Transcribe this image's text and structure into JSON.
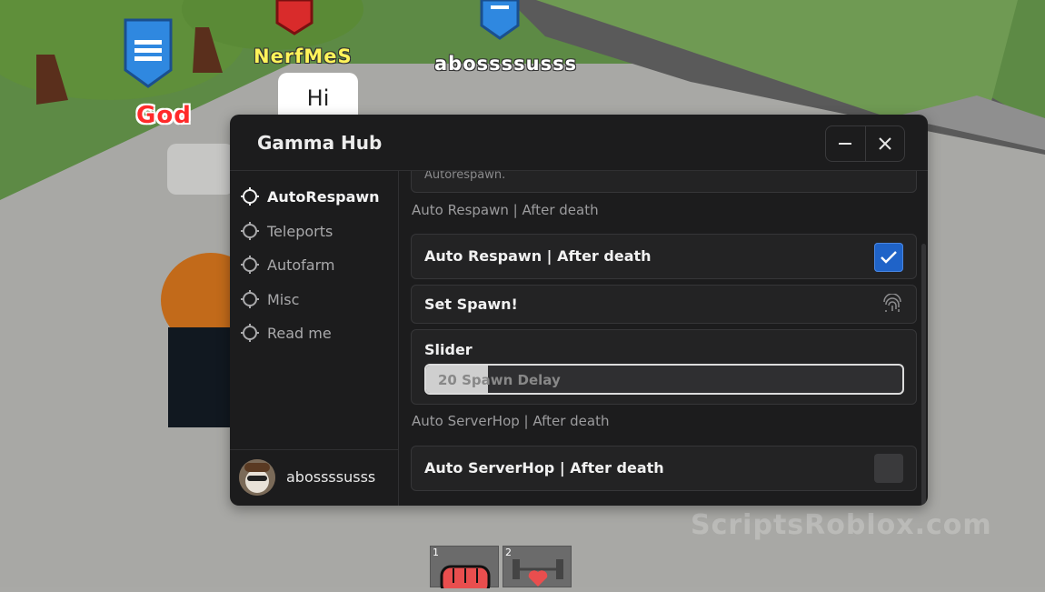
{
  "world": {
    "nametags": {
      "god": "God",
      "nerf": "NerfMeS",
      "player": "abossssusss"
    },
    "chat_bubble": "Hi",
    "watermark": "ScriptsRoblox.com"
  },
  "window": {
    "title": "Gamma Hub",
    "controls": {
      "minimize": "minimize-icon",
      "close": "close-icon"
    }
  },
  "sidebar": {
    "items": [
      {
        "label": "AutoRespawn",
        "active": true
      },
      {
        "label": "Teleports",
        "active": false
      },
      {
        "label": "Autofarm",
        "active": false
      },
      {
        "label": "Misc",
        "active": false
      },
      {
        "label": "Read me",
        "active": false
      }
    ],
    "profile": {
      "username": "abossssusss"
    }
  },
  "content": {
    "top_card_text": "Autorespawn.",
    "section1": "Auto Respawn | After death",
    "toggle_respawn": {
      "label": "Auto Respawn | After death",
      "checked": true
    },
    "set_spawn": {
      "label": "Set Spawn!",
      "icon": "fingerprint-icon"
    },
    "slider": {
      "label": "Slider",
      "value": 20,
      "text": "20 Spawn Delay",
      "fill": 0.13
    },
    "section2": "Auto ServerHop | After death",
    "toggle_serverhop": {
      "label": "Auto ServerHop | After death",
      "checked": false
    }
  },
  "hotbar": [
    {
      "num": "1",
      "icon": "fist-icon"
    },
    {
      "num": "2",
      "icon": "dumbbell-heart-icon"
    }
  ]
}
